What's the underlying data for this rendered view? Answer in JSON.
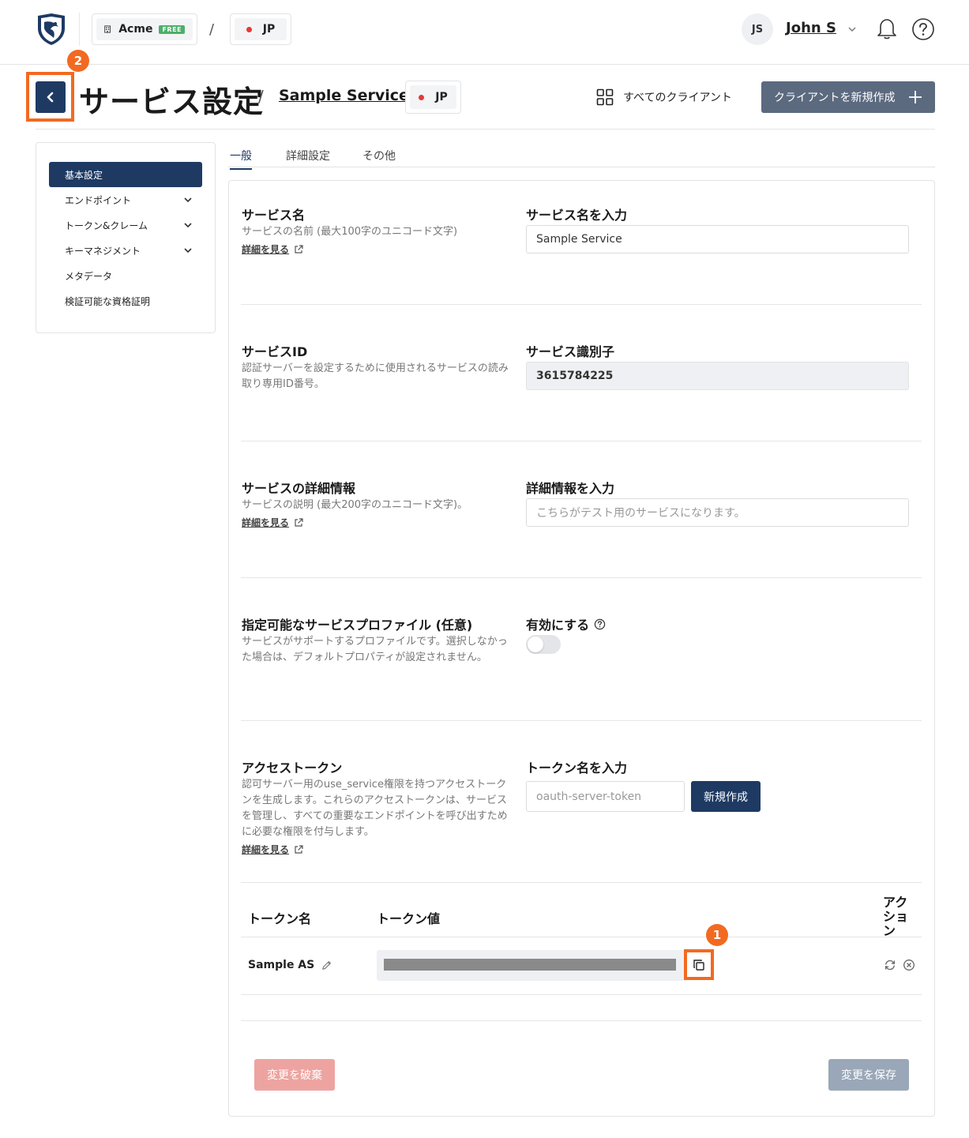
{
  "topnav": {
    "org": {
      "name": "Acme",
      "plan_badge": "FREE"
    },
    "separator": "/",
    "region": "JP",
    "user": {
      "initials": "JS",
      "name": "John S"
    }
  },
  "header": {
    "title": "サービス設定",
    "separator": "/",
    "service_name": "Sample Service",
    "region": "JP",
    "all_clients_label": "すべてのクライアント",
    "new_client_label": "クライアントを新規作成"
  },
  "sidebar": {
    "items": [
      {
        "label": "基本設定",
        "active": true,
        "expandable": false
      },
      {
        "label": "エンドポイント",
        "active": false,
        "expandable": true
      },
      {
        "label": "トークン&クレーム",
        "active": false,
        "expandable": true
      },
      {
        "label": "キーマネジメント",
        "active": false,
        "expandable": true
      },
      {
        "label": "メタデータ",
        "active": false,
        "expandable": false
      },
      {
        "label": "検証可能な資格証明",
        "active": false,
        "expandable": false
      }
    ]
  },
  "tabs": [
    {
      "label": "一般",
      "active": true
    },
    {
      "label": "詳細設定",
      "active": false
    },
    {
      "label": "その他",
      "active": false
    }
  ],
  "sections": {
    "service_name": {
      "title": "サービス名",
      "desc": "サービスの名前 (最大100字のユニコード文字)",
      "link": "詳細を見る",
      "field_label": "サービス名を入力",
      "value": "Sample Service"
    },
    "service_id": {
      "title": "サービスID",
      "desc": "認証サーバーを設定するために使用されるサービスの読み取り専用ID番号。",
      "field_label": "サービス識別子",
      "value": "3615784225"
    },
    "service_details": {
      "title": "サービスの詳細情報",
      "desc": "サービスの説明 (最大200字のユニコード文字)。",
      "link": "詳細を見る",
      "field_label": "詳細情報を入力",
      "placeholder": "こちらがテスト用のサービスになります。"
    },
    "profile": {
      "title": "指定可能なサービスプロファイル (任意)",
      "desc": "サービスがサポートするプロファイルです。選択しなかった場合は、デフォルトプロパティが設定されません。",
      "field_label": "有効にする",
      "enabled": false
    },
    "access_token": {
      "title": "アクセストークン",
      "desc": "認可サーバー用のuse_service権限を持つアクセストークンを生成します。これらのアクセストークンは、サービスを管理し、すべての重要なエンドポイントを呼び出すために必要な権限を付与します。",
      "link": "詳細を見る",
      "field_label": "トークン名を入力",
      "placeholder": "oauth-server-token",
      "create_label": "新規作成"
    }
  },
  "token_table": {
    "columns": [
      "トークン名",
      "トークン値",
      "アクション"
    ],
    "rows": [
      {
        "name": "Sample AS",
        "value_masked": true
      }
    ]
  },
  "footer": {
    "discard_label": "変更を破棄",
    "save_label": "変更を保存"
  },
  "annotations": {
    "copy_marker": "1",
    "back_marker": "2"
  },
  "colors": {
    "primary": "#1e3a63",
    "highlight": "#f26a21",
    "region_dot": "#e53935",
    "free_badge": "#4caf6a",
    "discard": "#eda4a1",
    "save_disabled": "#9aa7b8"
  }
}
